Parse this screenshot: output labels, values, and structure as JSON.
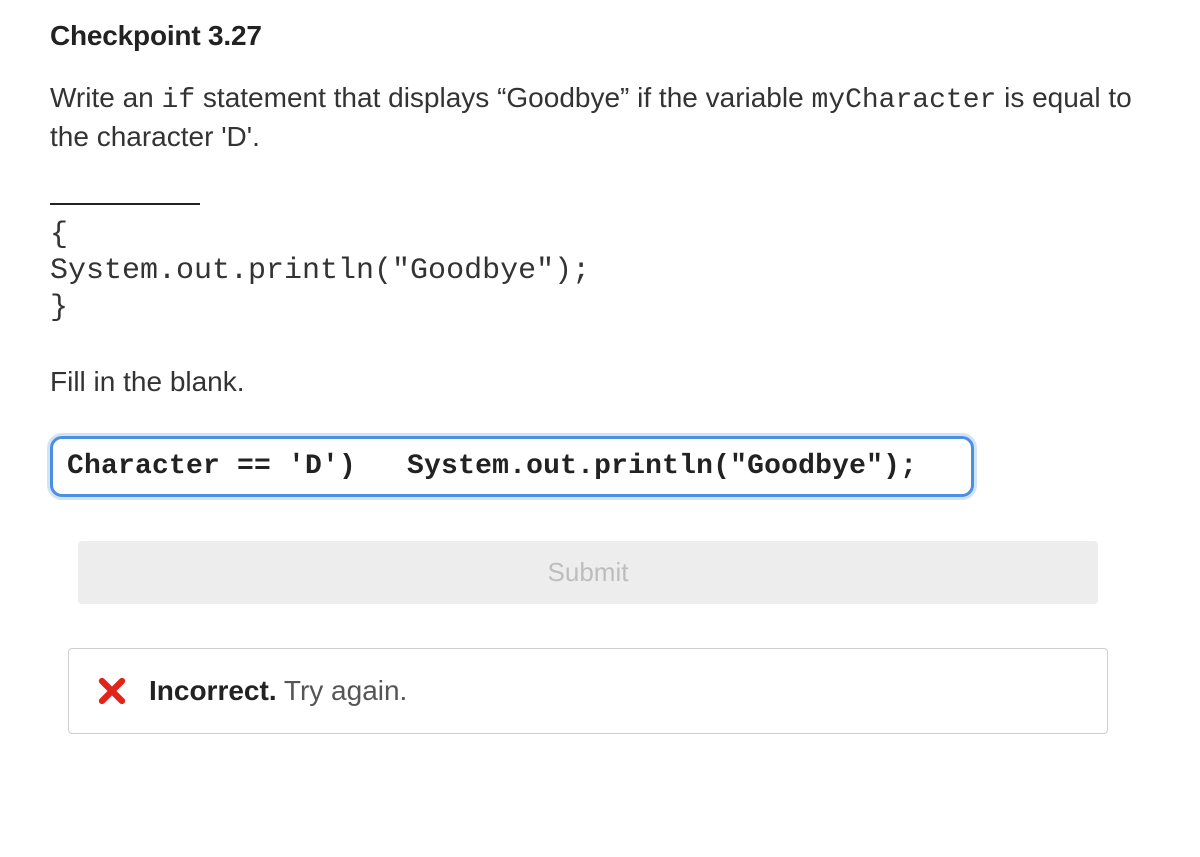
{
  "heading": "Checkpoint 3.27",
  "prompt": {
    "pre1": "Write an ",
    "code1": "if",
    "mid1": " statement that displays “Goodbye” if the variable ",
    "code2": "myCharacter",
    "post1": " is equal to the character 'D'."
  },
  "code_block": {
    "line1": "{",
    "line2": "System.out.println(\"Goodbye\");",
    "line3": "}"
  },
  "fill_label": "Fill in the blank.",
  "answer_value": "Character == 'D')   System.out.println(\"Goodbye\");",
  "submit_label": "Submit",
  "feedback": {
    "strong": "Incorrect.",
    "rest": " Try again."
  }
}
